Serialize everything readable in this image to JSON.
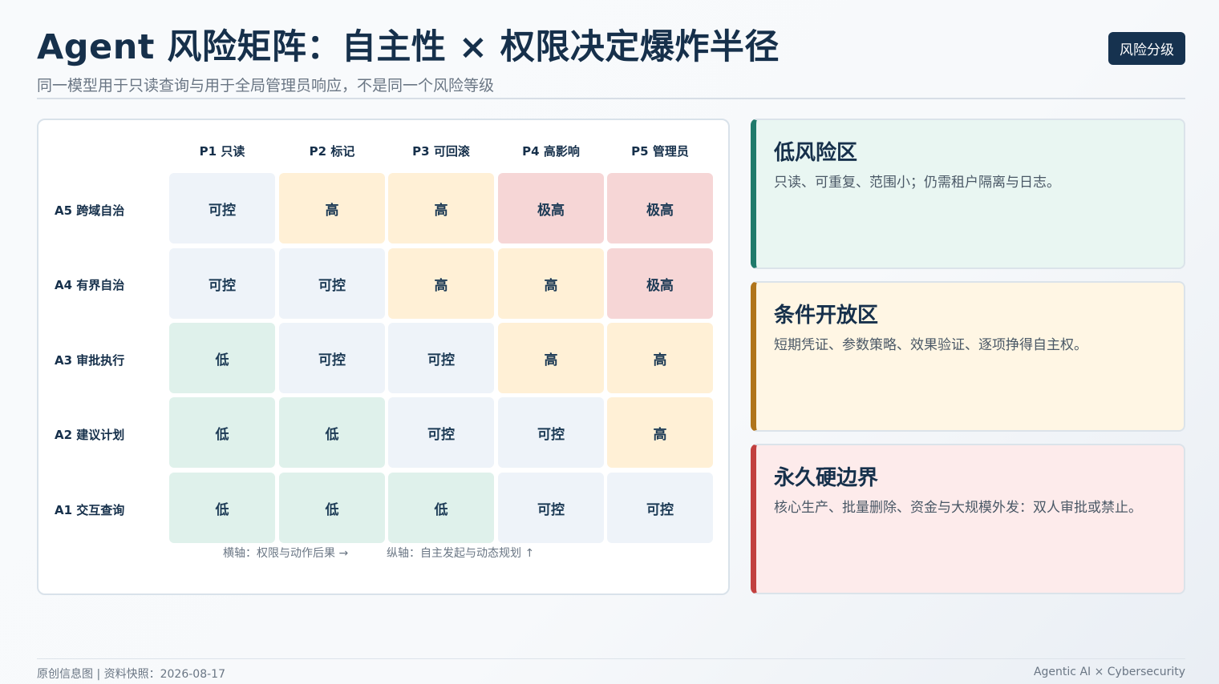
{
  "header": {
    "title": "Agent 风险矩阵：自主性 × 权限决定爆炸半径",
    "subtitle": "同一模型用于只读查询与用于全局管理员响应，不是同一个风险等级",
    "badge": "风险分级"
  },
  "matrix": {
    "columns": [
      "P1 只读",
      "P2 标记",
      "P3 可回滚",
      "P4 高影响",
      "P5 管理员"
    ],
    "rows": [
      {
        "label": "A5 跨域自治",
        "cells": [
          "可控",
          "高",
          "高",
          "极高",
          "极高"
        ]
      },
      {
        "label": "A4 有界自治",
        "cells": [
          "可控",
          "可控",
          "高",
          "高",
          "极高"
        ]
      },
      {
        "label": "A3 审批执行",
        "cells": [
          "低",
          "可控",
          "可控",
          "高",
          "高"
        ]
      },
      {
        "label": "A2 建议计划",
        "cells": [
          "低",
          "低",
          "可控",
          "可控",
          "高"
        ]
      },
      {
        "label": "A1 交互查询",
        "cells": [
          "低",
          "低",
          "低",
          "可控",
          "可控"
        ]
      }
    ],
    "x_axis_note": "横轴：权限与动作后果 →",
    "y_axis_note": "纵轴：自主发起与动态规划 ↑",
    "level_colors": {
      "低": "#dff1eb",
      "可控": "#eef3f9",
      "高": "#fff0d6",
      "极高": "#f6d6d6"
    }
  },
  "zones": [
    {
      "title": "低风险区",
      "desc": "只读、可重复、范围小；仍需租户隔离与日志。",
      "accent": "#1f7a6b",
      "bg": "#e9f6f2"
    },
    {
      "title": "条件开放区",
      "desc": "短期凭证、参数策略、效果验证、逐项挣得自主权。",
      "accent": "#b0741a",
      "bg": "#fff6e4"
    },
    {
      "title": "永久硬边界",
      "desc": "核心生产、批量删除、资金与大规模外发：双人审批或禁止。",
      "accent": "#c2403f",
      "bg": "#fdebeb"
    }
  ],
  "footer": {
    "left": "原创信息图 | 资料快照：2026-08-17",
    "right": "Agentic AI × Cybersecurity"
  }
}
